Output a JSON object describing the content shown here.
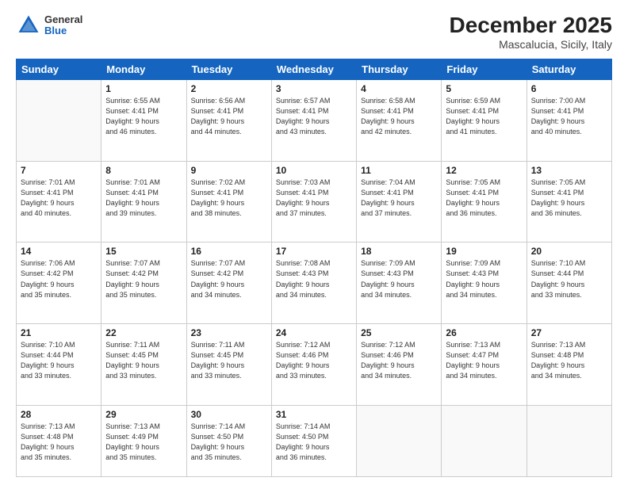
{
  "header": {
    "logo": {
      "line1": "General",
      "line2": "Blue"
    },
    "title": "December 2025",
    "location": "Mascalucia, Sicily, Italy"
  },
  "days_of_week": [
    "Sunday",
    "Monday",
    "Tuesday",
    "Wednesday",
    "Thursday",
    "Friday",
    "Saturday"
  ],
  "weeks": [
    [
      {
        "day": "",
        "info": ""
      },
      {
        "day": "1",
        "info": "Sunrise: 6:55 AM\nSunset: 4:41 PM\nDaylight: 9 hours\nand 46 minutes."
      },
      {
        "day": "2",
        "info": "Sunrise: 6:56 AM\nSunset: 4:41 PM\nDaylight: 9 hours\nand 44 minutes."
      },
      {
        "day": "3",
        "info": "Sunrise: 6:57 AM\nSunset: 4:41 PM\nDaylight: 9 hours\nand 43 minutes."
      },
      {
        "day": "4",
        "info": "Sunrise: 6:58 AM\nSunset: 4:41 PM\nDaylight: 9 hours\nand 42 minutes."
      },
      {
        "day": "5",
        "info": "Sunrise: 6:59 AM\nSunset: 4:41 PM\nDaylight: 9 hours\nand 41 minutes."
      },
      {
        "day": "6",
        "info": "Sunrise: 7:00 AM\nSunset: 4:41 PM\nDaylight: 9 hours\nand 40 minutes."
      }
    ],
    [
      {
        "day": "7",
        "info": "Sunrise: 7:01 AM\nSunset: 4:41 PM\nDaylight: 9 hours\nand 40 minutes."
      },
      {
        "day": "8",
        "info": "Sunrise: 7:01 AM\nSunset: 4:41 PM\nDaylight: 9 hours\nand 39 minutes."
      },
      {
        "day": "9",
        "info": "Sunrise: 7:02 AM\nSunset: 4:41 PM\nDaylight: 9 hours\nand 38 minutes."
      },
      {
        "day": "10",
        "info": "Sunrise: 7:03 AM\nSunset: 4:41 PM\nDaylight: 9 hours\nand 37 minutes."
      },
      {
        "day": "11",
        "info": "Sunrise: 7:04 AM\nSunset: 4:41 PM\nDaylight: 9 hours\nand 37 minutes."
      },
      {
        "day": "12",
        "info": "Sunrise: 7:05 AM\nSunset: 4:41 PM\nDaylight: 9 hours\nand 36 minutes."
      },
      {
        "day": "13",
        "info": "Sunrise: 7:05 AM\nSunset: 4:41 PM\nDaylight: 9 hours\nand 36 minutes."
      }
    ],
    [
      {
        "day": "14",
        "info": "Sunrise: 7:06 AM\nSunset: 4:42 PM\nDaylight: 9 hours\nand 35 minutes."
      },
      {
        "day": "15",
        "info": "Sunrise: 7:07 AM\nSunset: 4:42 PM\nDaylight: 9 hours\nand 35 minutes."
      },
      {
        "day": "16",
        "info": "Sunrise: 7:07 AM\nSunset: 4:42 PM\nDaylight: 9 hours\nand 34 minutes."
      },
      {
        "day": "17",
        "info": "Sunrise: 7:08 AM\nSunset: 4:43 PM\nDaylight: 9 hours\nand 34 minutes."
      },
      {
        "day": "18",
        "info": "Sunrise: 7:09 AM\nSunset: 4:43 PM\nDaylight: 9 hours\nand 34 minutes."
      },
      {
        "day": "19",
        "info": "Sunrise: 7:09 AM\nSunset: 4:43 PM\nDaylight: 9 hours\nand 34 minutes."
      },
      {
        "day": "20",
        "info": "Sunrise: 7:10 AM\nSunset: 4:44 PM\nDaylight: 9 hours\nand 33 minutes."
      }
    ],
    [
      {
        "day": "21",
        "info": "Sunrise: 7:10 AM\nSunset: 4:44 PM\nDaylight: 9 hours\nand 33 minutes."
      },
      {
        "day": "22",
        "info": "Sunrise: 7:11 AM\nSunset: 4:45 PM\nDaylight: 9 hours\nand 33 minutes."
      },
      {
        "day": "23",
        "info": "Sunrise: 7:11 AM\nSunset: 4:45 PM\nDaylight: 9 hours\nand 33 minutes."
      },
      {
        "day": "24",
        "info": "Sunrise: 7:12 AM\nSunset: 4:46 PM\nDaylight: 9 hours\nand 33 minutes."
      },
      {
        "day": "25",
        "info": "Sunrise: 7:12 AM\nSunset: 4:46 PM\nDaylight: 9 hours\nand 34 minutes."
      },
      {
        "day": "26",
        "info": "Sunrise: 7:13 AM\nSunset: 4:47 PM\nDaylight: 9 hours\nand 34 minutes."
      },
      {
        "day": "27",
        "info": "Sunrise: 7:13 AM\nSunset: 4:48 PM\nDaylight: 9 hours\nand 34 minutes."
      }
    ],
    [
      {
        "day": "28",
        "info": "Sunrise: 7:13 AM\nSunset: 4:48 PM\nDaylight: 9 hours\nand 35 minutes."
      },
      {
        "day": "29",
        "info": "Sunrise: 7:13 AM\nSunset: 4:49 PM\nDaylight: 9 hours\nand 35 minutes."
      },
      {
        "day": "30",
        "info": "Sunrise: 7:14 AM\nSunset: 4:50 PM\nDaylight: 9 hours\nand 35 minutes."
      },
      {
        "day": "31",
        "info": "Sunrise: 7:14 AM\nSunset: 4:50 PM\nDaylight: 9 hours\nand 36 minutes."
      },
      {
        "day": "",
        "info": ""
      },
      {
        "day": "",
        "info": ""
      },
      {
        "day": "",
        "info": ""
      }
    ]
  ]
}
